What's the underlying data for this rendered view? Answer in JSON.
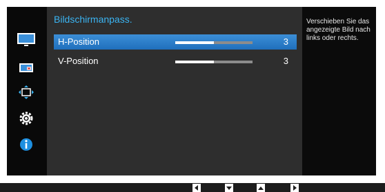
{
  "menu": {
    "title": "Bildschirmanpass.",
    "items": [
      {
        "label": "H-Position",
        "value": "3",
        "level": 0.5,
        "selected": true
      },
      {
        "label": "V-Position",
        "value": "3",
        "level": 0.5,
        "selected": false
      }
    ]
  },
  "help": {
    "text": "Verschieben Sie das angezeigte Bild nach links oder rechts."
  },
  "sidebar": {
    "icons": [
      "picture-icon",
      "onscreen-display-icon",
      "position-icon",
      "gear-icon",
      "info-icon"
    ],
    "selected": "position-icon"
  },
  "colors": {
    "accent": "#3bb4f2",
    "selection": "#2f80cc",
    "panel": "#2e2e2e",
    "background": "#0b0b0b"
  },
  "nav_buttons": [
    "left-arrow-icon",
    "down-arrow-icon",
    "up-arrow-icon",
    "right-arrow-icon"
  ]
}
